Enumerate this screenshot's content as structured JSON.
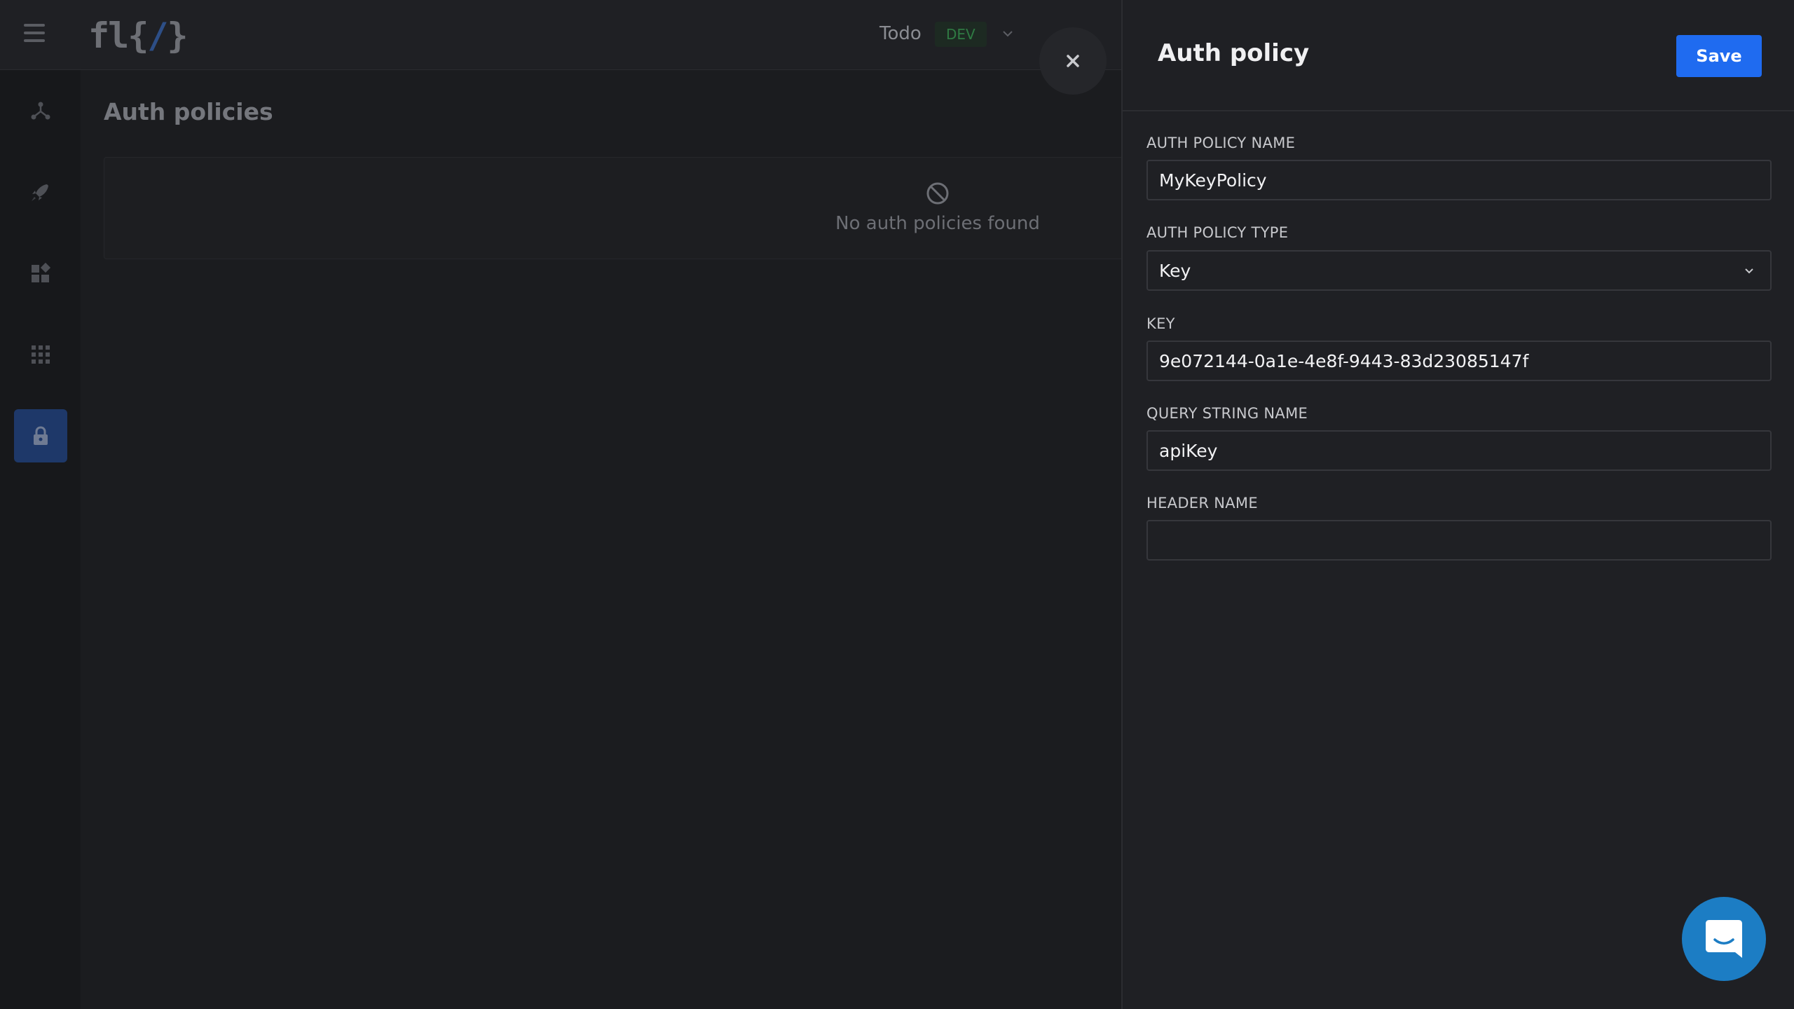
{
  "topbar": {
    "logo_prefix": "fl{",
    "logo_slash": "/",
    "logo_suffix": "}",
    "project_name": "Todo",
    "environment": "DEV"
  },
  "sidebar": {
    "items": [
      {
        "name": "flows",
        "icon": "network-icon",
        "active": false
      },
      {
        "name": "deploy",
        "icon": "rocket-icon",
        "active": false
      },
      {
        "name": "integrations",
        "icon": "widgets-icon",
        "active": false
      },
      {
        "name": "apps",
        "icon": "grid-icon",
        "active": false
      },
      {
        "name": "security",
        "icon": "lock-icon",
        "active": true
      }
    ]
  },
  "main": {
    "title": "Auth policies",
    "empty_text": "No auth policies found"
  },
  "drawer": {
    "title": "Auth policy",
    "save_label": "Save",
    "fields": {
      "name_label": "AUTH POLICY NAME",
      "name_value": "MyKeyPolicy",
      "type_label": "AUTH POLICY TYPE",
      "type_value": "Key",
      "key_label": "KEY",
      "key_value": "9e072144-0a1e-4e8f-9443-83d23085147f",
      "query_label": "QUERY STRING NAME",
      "query_value": "apiKey",
      "header_label": "HEADER NAME",
      "header_value": ""
    }
  },
  "colors": {
    "accent": "#1f6bf0",
    "active_nav": "#1e3869",
    "chat": "#1c7dc4",
    "env_badge_text": "#2f7a43"
  }
}
